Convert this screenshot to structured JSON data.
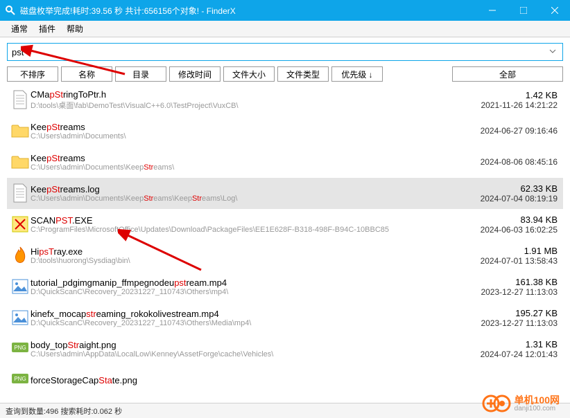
{
  "title": "磁盘枚举完成!耗时:39.56 秒 共计:656156个对象!   -  FinderX",
  "menu": {
    "m0": "通常",
    "m1": "插件",
    "m2": "帮助"
  },
  "search": {
    "value": "pst"
  },
  "headers": {
    "h0": "不排序",
    "h1": "名称",
    "h2": "目录",
    "h3": "修改时间",
    "h4": "文件大小",
    "h5": "文件类型",
    "h6": "优先级 ↓",
    "h7": "全部"
  },
  "status": "查询到数量:496    搜索耗时:0.062 秒",
  "watermark": {
    "t": "单机100网",
    "s": "danji100.com"
  },
  "rows": [
    {
      "name": "CMapStringToPtr.h",
      "path": "D:\\tools\\桌面\\fab\\DemoTest\\VisualC++6.0\\TestProject\\VuxCB\\",
      "size": "1.42 KB",
      "date": "2021-11-26 14:21:22",
      "icon": "file",
      "hl": [
        [
          3,
          3
        ]
      ],
      "phl": []
    },
    {
      "name": "KeepStreams",
      "path": "C:\\Users\\admin\\Documents\\",
      "size": "",
      "date": "2024-06-27 09:16:46",
      "icon": "folder",
      "hl": [
        [
          3,
          3
        ]
      ],
      "phl": []
    },
    {
      "name": "KeepStreams",
      "path": "C:\\Users\\admin\\Documents\\KeepStreams\\",
      "size": "",
      "date": "2024-08-06 08:45:16",
      "icon": "folder",
      "hl": [
        [
          3,
          3
        ]
      ],
      "phl": [
        [
          29,
          3
        ]
      ]
    },
    {
      "name": "KeepStreams.log",
      "path": "C:\\Users\\admin\\Documents\\KeepStreams\\KeepStreams\\Log\\",
      "size": "62.33 KB",
      "date": "2024-07-04 08:19:19",
      "icon": "log",
      "hl": [
        [
          3,
          3
        ]
      ],
      "phl": [
        [
          29,
          3
        ],
        [
          41,
          3
        ]
      ],
      "sel": true
    },
    {
      "name": "SCANPST.EXE",
      "path": "C:\\ProgramFiles\\MicrosoftOffice\\Updates\\Download\\PackageFiles\\EE1E628F-B318-498F-B94C-10BBC85",
      "size": "83.94 KB",
      "date": "2024-06-03 16:02:25",
      "icon": "x",
      "hl": [
        [
          4,
          3
        ]
      ],
      "phl": []
    },
    {
      "name": "HipsTray.exe",
      "path": "D:\\tools\\huorong\\Sysdiag\\bin\\",
      "size": "1.91 MB",
      "date": "2024-07-01 13:58:43",
      "icon": "fire",
      "hl": [
        [
          2,
          3
        ]
      ],
      "phl": []
    },
    {
      "name": "tutorial_pdgimgmanip_ffmpegnodeupstream.mp4",
      "path": "D:\\QuickScanC\\Recovery_20231227_110743\\Others\\mp4\\",
      "size": "161.38 KB",
      "date": "2023-12-27 11:13:03",
      "icon": "img",
      "hl": [
        [
          32,
          3
        ]
      ],
      "phl": []
    },
    {
      "name": "kinefx_mocapstreaming_rokokolivestream.mp4",
      "path": "D:\\QuickScanC\\Recovery_20231227_110743\\Others\\Media\\mp4\\",
      "size": "195.27 KB",
      "date": "2023-12-27 11:13:03",
      "icon": "img",
      "hl": [
        [
          12,
          3
        ]
      ],
      "phl": []
    },
    {
      "name": "body_topStraight.png",
      "path": "C:\\Users\\admin\\AppData\\LocalLow\\Kenney\\AssetForge\\cache\\Vehicles\\",
      "size": "1.31 KB",
      "date": "2024-07-24 12:01:43",
      "icon": "png",
      "hl": [
        [
          8,
          3
        ]
      ],
      "phl": []
    },
    {
      "name": "forceStorageCapState.png",
      "path": "",
      "size": "",
      "date": "",
      "icon": "png",
      "hl": [
        [
          15,
          3
        ]
      ],
      "phl": []
    }
  ],
  "chart_data": {
    "type": "table",
    "columns": [
      "name",
      "path",
      "size",
      "date"
    ],
    "note": "file search results listing"
  }
}
